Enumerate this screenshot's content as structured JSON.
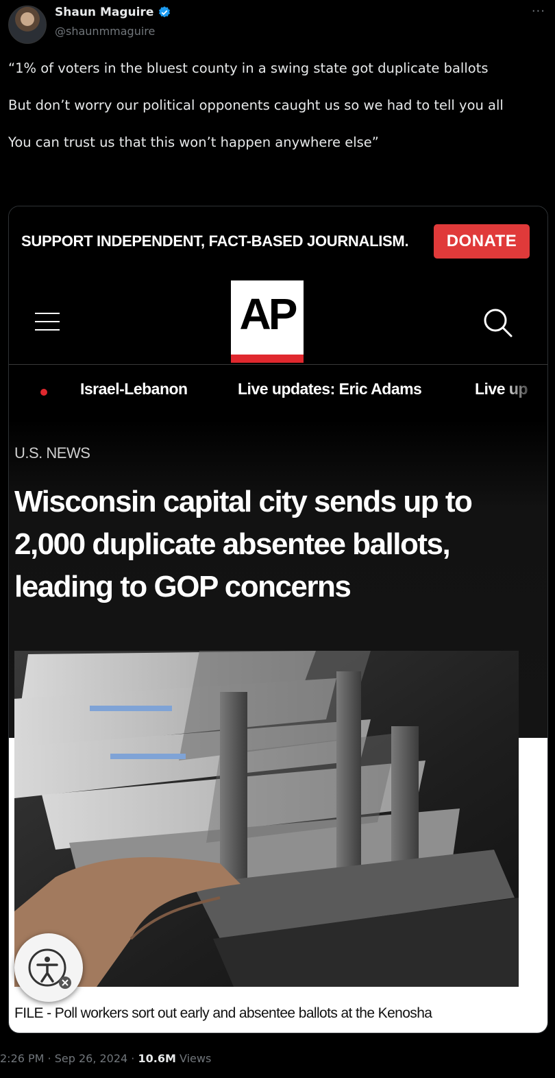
{
  "tweet": {
    "display_name": "Shaun Maguire",
    "handle": "@shaunmmaguire",
    "paragraphs": [
      "“1% of voters in the bluest county in a swing state got duplicate ballots",
      "But don’t worry our political opponents caught us so we had to tell you all",
      "You can trust us that this won’t happen anywhere else”"
    ],
    "more_label": "···",
    "timestamp": "2:26 PM · Sep 26, 2024 · ",
    "views_count": "10.6M",
    "views_label": " Views"
  },
  "article": {
    "promo_text": "SUPPORT INDEPENDENT, FACT-BASED JOURNALISM.",
    "donate_label": "DONATE",
    "logo_text": "AP",
    "nav": [
      "Israel-Lebanon",
      "Live updates: Eric Adams",
      "Live up"
    ],
    "section": "U.S. NEWS",
    "headline": "Wisconsin capital city sends up to 2,000 duplicate absentee ballots, leading to GOP concerns",
    "caption": "FILE - Poll workers sort out early and absentee ballots at the Kenosha"
  },
  "colors": {
    "background": "#000000",
    "verified": "#1d9bf0",
    "donate": "#e03a3a",
    "ap_red": "#e0282e",
    "muted_text": "#71767b"
  },
  "icons": [
    "verified-badge-icon",
    "more-icon",
    "hamburger-menu-icon",
    "search-icon",
    "accessibility-icon"
  ]
}
